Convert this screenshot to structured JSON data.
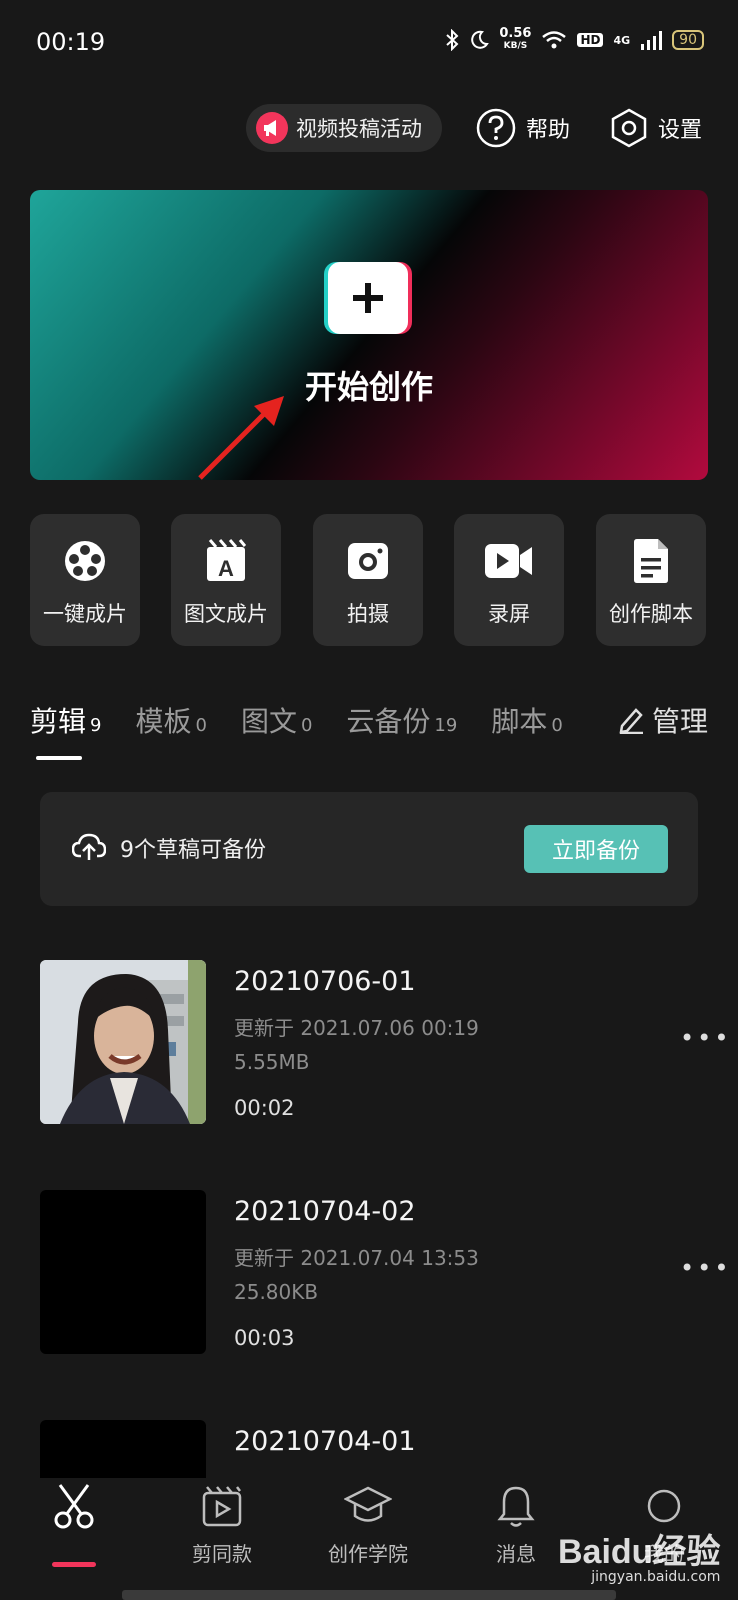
{
  "status_bar": {
    "time": "00:19",
    "net_speed": "0.56",
    "net_unit": "KB/S",
    "hd_badge": "HD",
    "network": "4G",
    "battery": "90"
  },
  "header": {
    "activity_label": "视频投稿活动",
    "help_label": "帮助",
    "settings_label": "设置"
  },
  "banner": {
    "label": "开始创作"
  },
  "tools": [
    {
      "label": "一键成片",
      "icon": "film-reel-icon"
    },
    {
      "label": "图文成片",
      "icon": "text-clapper-icon"
    },
    {
      "label": "拍摄",
      "icon": "camera-icon"
    },
    {
      "label": "录屏",
      "icon": "screen-record-icon"
    },
    {
      "label": "创作脚本",
      "icon": "script-doc-icon"
    }
  ],
  "tabs": [
    {
      "label": "剪辑",
      "count": "9"
    },
    {
      "label": "模板",
      "count": "0"
    },
    {
      "label": "图文",
      "count": "0"
    },
    {
      "label": "云备份",
      "count": "19"
    },
    {
      "label": "脚本",
      "count": "0"
    }
  ],
  "manage_label": "管理",
  "backup": {
    "text": "9个草稿可备份",
    "button": "立即备份"
  },
  "drafts": [
    {
      "title": "20210706-01",
      "updated": "更新于 2021.07.06 00:19",
      "size": "5.55MB",
      "duration": "00:02"
    },
    {
      "title": "20210704-02",
      "updated": "更新于 2021.07.04 13:53",
      "size": "25.80KB",
      "duration": "00:03"
    },
    {
      "title": "20210704-01"
    }
  ],
  "bottom_nav": [
    {
      "label": "",
      "icon": "scissors-icon"
    },
    {
      "label": "剪同款",
      "icon": "clapper-icon"
    },
    {
      "label": "创作学院",
      "icon": "graduation-cap-icon"
    },
    {
      "label": "消息",
      "icon": "bell-icon"
    },
    {
      "label": "我的",
      "icon": "profile-icon"
    }
  ],
  "watermark": {
    "main": "Baidu经验",
    "sub": "jingyan.baidu.com"
  },
  "colors": {
    "background": "#181818",
    "accent_teal": "#57c1b5",
    "accent_red": "#f2355b"
  }
}
